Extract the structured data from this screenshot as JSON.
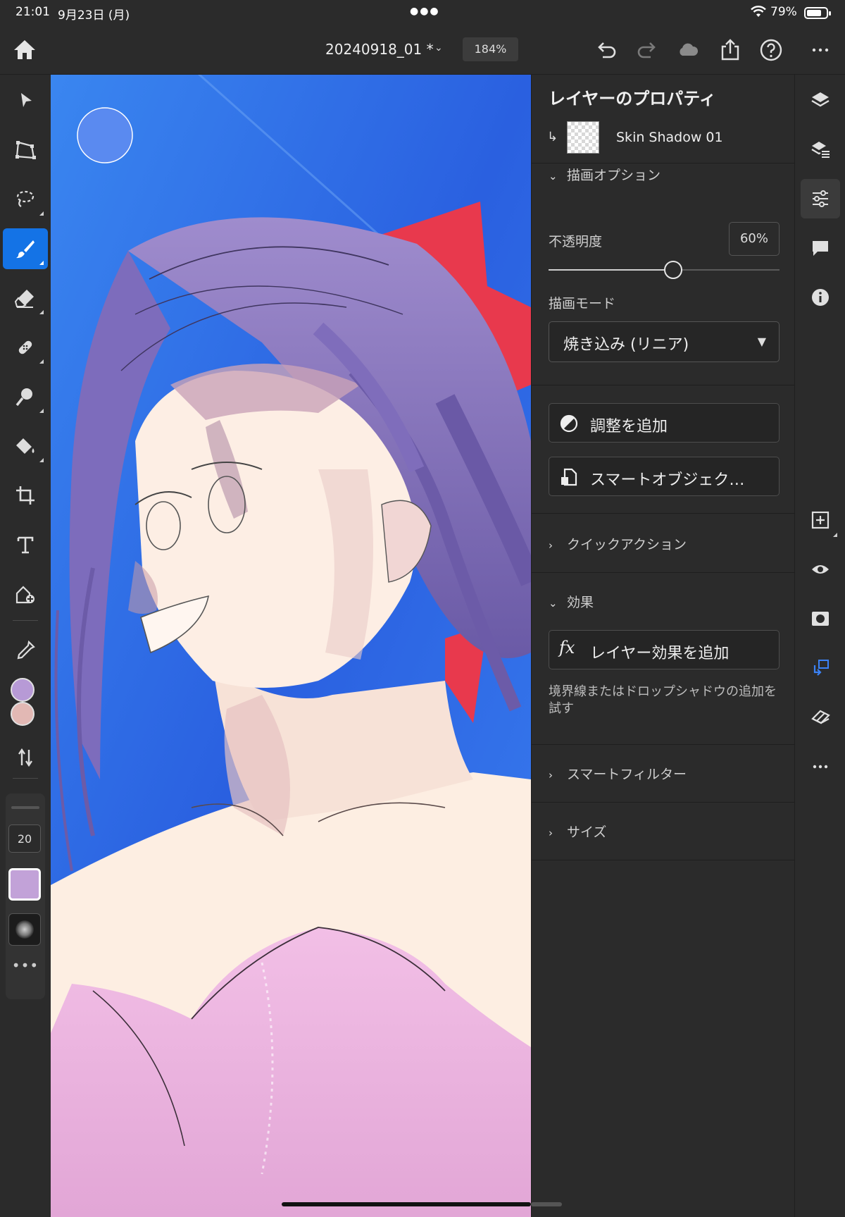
{
  "status_bar": {
    "time": "21:01",
    "date": "9月23日 (月)",
    "battery": "79%"
  },
  "top_bar": {
    "document_title": "20240918_01 *",
    "zoom": "184%"
  },
  "properties": {
    "title": "レイヤーのプロパティ",
    "layer_name": "Skin Shadow 01",
    "draw_options_header": "描画オプション",
    "opacity_label": "不透明度",
    "opacity_value": "60%",
    "opacity_fraction": 0.6,
    "blend_mode_label": "描画モード",
    "blend_mode_value": "焼き込み (リニア)",
    "add_adjustment": "調整を追加",
    "smart_object": "スマートオブジェク…",
    "quick_actions_header": "クイックアクション",
    "effects_header": "効果",
    "add_layer_effect": "レイヤー効果を追加",
    "effects_hint": "境界線またはドロップシャドウの追加を試す",
    "smart_filter_header": "スマートフィルター",
    "size_header": "サイズ"
  },
  "tools": {
    "active_tool": "brush-tool",
    "brush_size": "20",
    "foreground_color": "#b79ad6",
    "background_color": "#e2b8b4",
    "brush_color": "#c2a2d8"
  },
  "colors": {
    "accent": "#1473e6",
    "panel_bg": "#2b2b2b"
  }
}
